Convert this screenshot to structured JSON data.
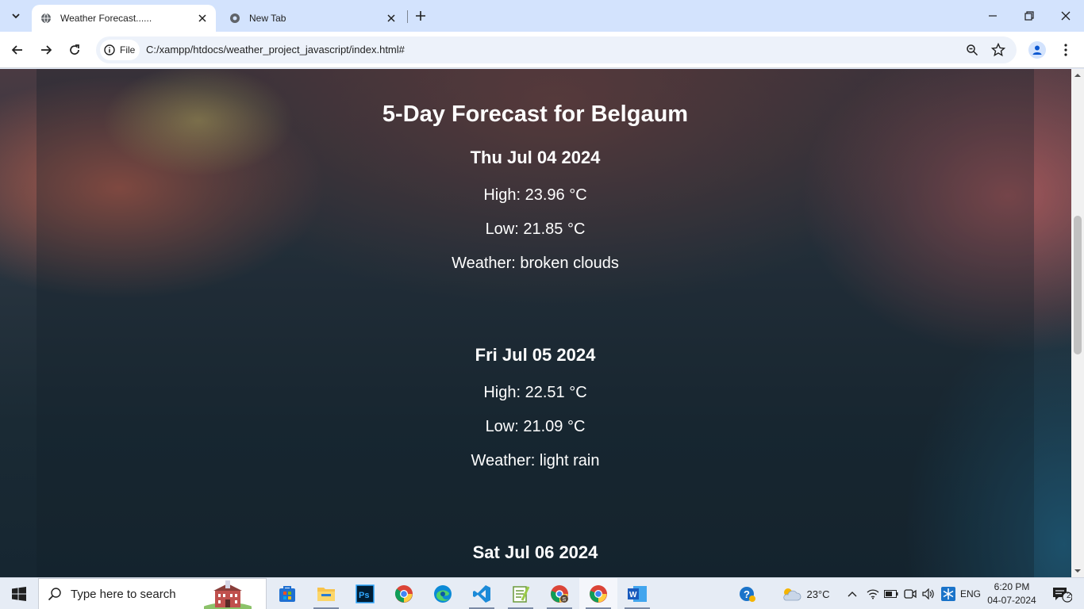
{
  "browser": {
    "tabs": [
      {
        "title": "Weather Forecast......",
        "active": true
      },
      {
        "title": "New Tab",
        "active": false
      }
    ],
    "site_chip": "File",
    "url": "C:/xampp/htdocs/weather_project_javascript/index.html#"
  },
  "page": {
    "heading": "5-Day Forecast for Belgaum",
    "days": [
      {
        "date": "Thu Jul 04 2024",
        "high": "High: 23.96 °C",
        "low": "Low: 21.85 °C",
        "weather": "Weather: broken clouds"
      },
      {
        "date": "Fri Jul 05 2024",
        "high": "High: 22.51 °C",
        "low": "Low: 21.09 °C",
        "weather": "Weather: light rain"
      },
      {
        "date": "Sat Jul 06 2024"
      }
    ]
  },
  "taskbar": {
    "search_placeholder": "Type here to search",
    "weather_temp": "23°C",
    "language": "ENG",
    "time": "6:20 PM",
    "date": "04-07-2024",
    "notification_count": "2",
    "apps": [
      "microsoft-store",
      "file-explorer",
      "photoshop",
      "chrome",
      "edge",
      "vscode",
      "notepad-plus",
      "chrome-profile-s",
      "chrome",
      "word"
    ]
  },
  "colors": {
    "tabstrip": "#d3e3fd",
    "toolbar": "#ffffff",
    "omnibox": "#edf2fa",
    "taskbar": "#e6ecf5",
    "text_on_page": "#ffffff"
  }
}
